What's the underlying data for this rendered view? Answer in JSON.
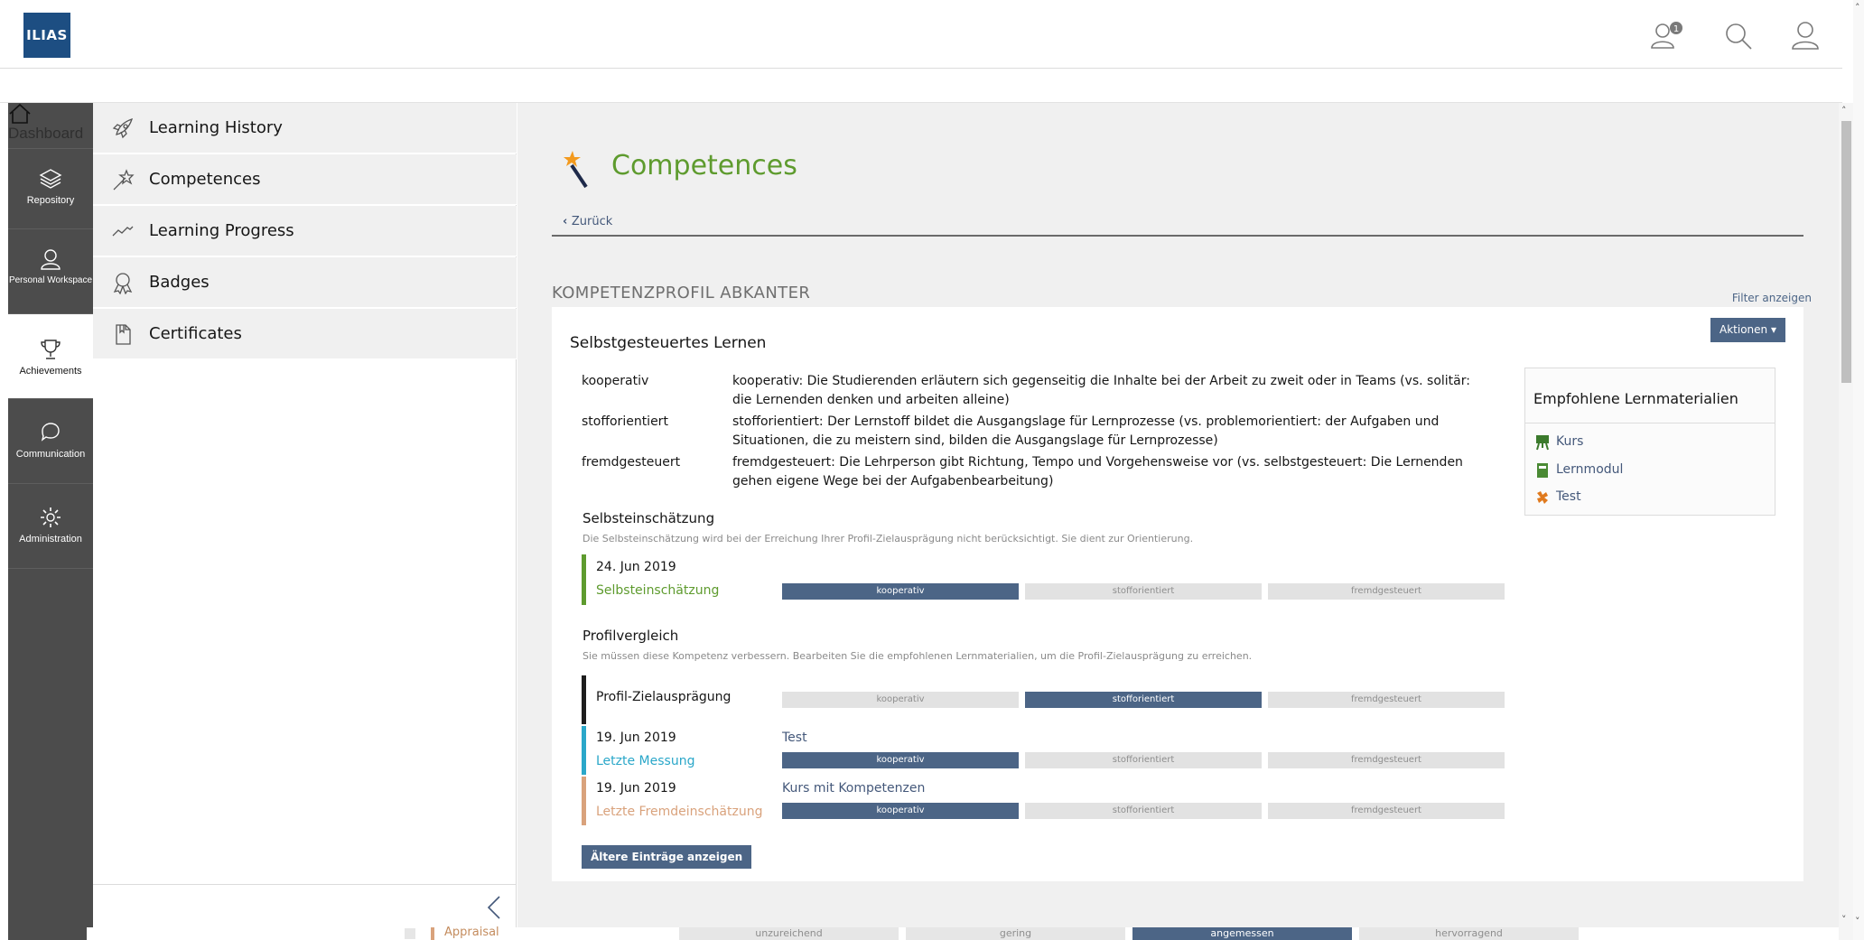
{
  "header": {
    "logo_text": "ILIAS",
    "notification_count": "1",
    "icons": [
      "user-notification-icon",
      "search-icon",
      "user-icon"
    ]
  },
  "mainbar": {
    "items": [
      {
        "label": "Dashboard",
        "icon": "home-icon"
      },
      {
        "label": "Repository",
        "icon": "layers-icon"
      },
      {
        "label": "Personal Workspace",
        "icon": "person-icon"
      },
      {
        "label": "Achievements",
        "icon": "trophy-icon"
      },
      {
        "label": "Communication",
        "icon": "chat-icon"
      },
      {
        "label": "Administration",
        "icon": "gear-icon"
      }
    ]
  },
  "slate": {
    "items": [
      {
        "label": "Learning History",
        "icon": "rocket-icon"
      },
      {
        "label": "Competences",
        "icon": "wand-icon"
      },
      {
        "label": "Learning Progress",
        "icon": "trend-icon"
      },
      {
        "label": "Badges",
        "icon": "badge-icon"
      },
      {
        "label": "Certificates",
        "icon": "certificate-icon"
      }
    ]
  },
  "content": {
    "title": "Competences",
    "back_label": "Zurück",
    "profile_heading": "KOMPETENZPROFIL ABKANTER",
    "filter_label": "Filter anzeigen",
    "actions_label": "Aktionen ▾",
    "competence": {
      "title": "Selbstgesteuertes Lernen",
      "levels": [
        {
          "name": "kooperativ",
          "description": "kooperativ: Die Studierenden erläutern sich gegenseitig die Inhalte bei der Arbeit zu zweit oder in Teams (vs. solitär: die Lernenden denken und arbeiten alleine)"
        },
        {
          "name": "stofforientiert",
          "description": "stofforientiert: Der Lernstoff bildet die Ausgangslage für Lernprozesse (vs. problemorientiert: der Aufgaben und Situationen, die zu meistern sind, bilden die Ausgangslage für Lernprozesse)"
        },
        {
          "name": "fremdgesteuert",
          "description": "fremdgesteuert: Die Lehrperson gibt Richtung, Tempo und Vorgehensweise vor (vs. selbstgesteuert: Die Lernenden gehen eigene Wege bei der Aufgabenbearbeitung)"
        }
      ],
      "scale_labels": [
        "kooperativ",
        "stofforientiert",
        "fremdgesteuert"
      ],
      "self_eval": {
        "title": "Selbsteinschätzung",
        "note": "Die Selbsteinschätzung wird bei der Erreichung Ihrer Profil-Zielausprägung nicht berücksichtigt. Sie dient zur Orientierung.",
        "date": "24. Jun 2019",
        "type": "Selbsteinschätzung",
        "selected_index": 0
      },
      "comparison": {
        "title": "Profilvergleich",
        "note": "Sie müssen diese Kompetenz verbessern. Bearbeiten Sie die empfohlenen Lernmaterialien, um die Profil-Zielausprägung zu erreichen.",
        "target_label": "Profil-Zielausprägung",
        "target_selected_index": 1,
        "entries": [
          {
            "date": "19. Jun 2019",
            "type": "Letzte Messung",
            "object": "Test",
            "selected_index": 0,
            "color": "#2aa7c9"
          },
          {
            "date": "19. Jun 2019",
            "type": "Letzte Fremdeinschätzung",
            "object": "Kurs mit Kompetenzen",
            "selected_index": 0,
            "color": "#d9a27c"
          }
        ]
      },
      "older_button": "Ältere Einträge anzeigen"
    },
    "recommended": {
      "title": "Empfohlene Lernmaterialien",
      "items": [
        {
          "label": "Kurs",
          "icon": "course-icon"
        },
        {
          "label": "Lernmodul",
          "icon": "learning-module-icon"
        },
        {
          "label": "Test",
          "icon": "test-icon"
        }
      ]
    }
  },
  "footer_row": {
    "label": "Appraisal",
    "scale": [
      "unzureichend",
      "gering",
      "angemessen",
      "hervorragend"
    ],
    "selected_index": 2
  },
  "colors": {
    "accent_green": "#5e9b2e",
    "button_blue": "#4c6586",
    "mainbar": "#4c4c4c"
  }
}
